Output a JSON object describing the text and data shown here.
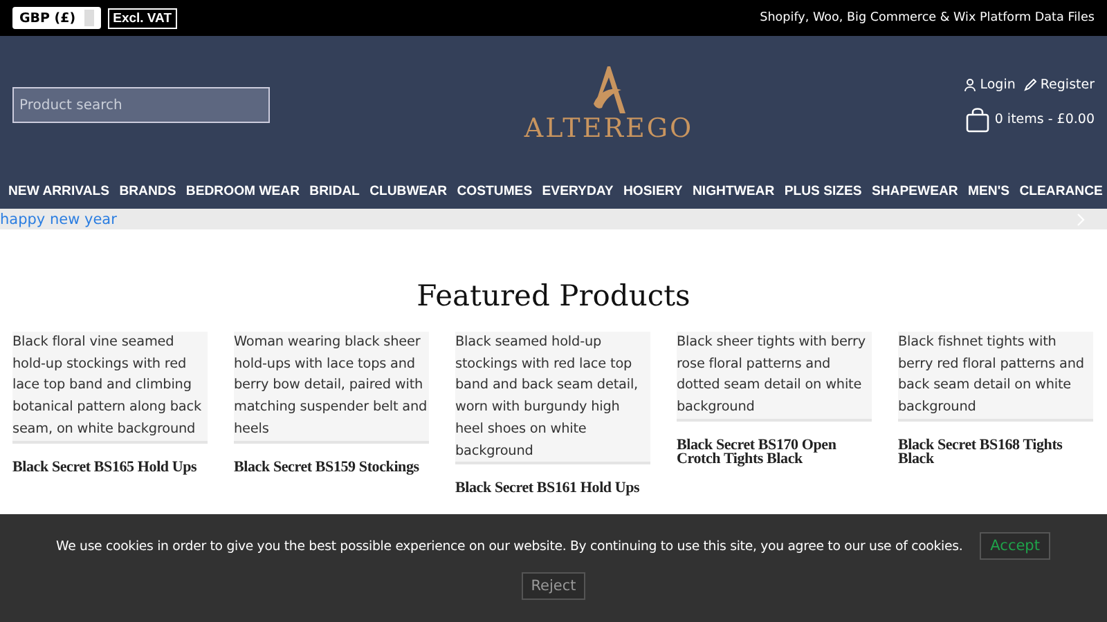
{
  "top_bar": {
    "currency": "GBP (£)",
    "vat_toggle": "Excl. VAT",
    "tagline": "Shopify, Woo, Big Commerce & Wix Platform Data Files"
  },
  "header": {
    "search": {
      "placeholder": "Product search"
    },
    "logo_text": "ALTEREGO",
    "login": "Login",
    "register": "Register",
    "cart": "0 items - £0.00"
  },
  "nav": [
    "NEW ARRIVALS",
    "BRANDS",
    "BEDROOM WEAR",
    "BRIDAL",
    "CLUBWEAR",
    "COSTUMES",
    "EVERYDAY",
    "HOSIERY",
    "NIGHTWEAR",
    "PLUS SIZES",
    "SHAPEWEAR",
    "MEN'S",
    "CLEARANCE"
  ],
  "banner": {
    "text": "happy new year"
  },
  "featured": {
    "title": "Featured Products",
    "products": [
      {
        "image_alt": "Black floral vine seamed hold-up stockings with red lace top band and climbing botanical pattern along back seam, on white background",
        "title": "Black Secret BS165 Hold Ups"
      },
      {
        "image_alt": "Woman wearing black sheer hold-ups with lace tops and berry bow detail, paired with matching suspender belt and heels",
        "title": "Black Secret BS159 Stockings"
      },
      {
        "image_alt": "Black seamed hold-up stockings with red lace top band and back seam detail, worn with burgundy high heel shoes on white background",
        "title": "Black Secret BS161 Hold Ups"
      },
      {
        "image_alt": "Black sheer tights with berry rose floral patterns and dotted seam detail on white background",
        "title": "Black Secret BS170 Open Crotch Tights Black"
      },
      {
        "image_alt": "Black fishnet tights with berry red floral patterns and back seam detail on white background",
        "title": "Black Secret BS168 Tights Black"
      }
    ]
  },
  "cookie_notice": {
    "text": "We use cookies in order to give you the best possible experience on our website. By continuing to use this site, you agree to our use of cookies.",
    "accept": "Accept",
    "reject": "Reject"
  }
}
